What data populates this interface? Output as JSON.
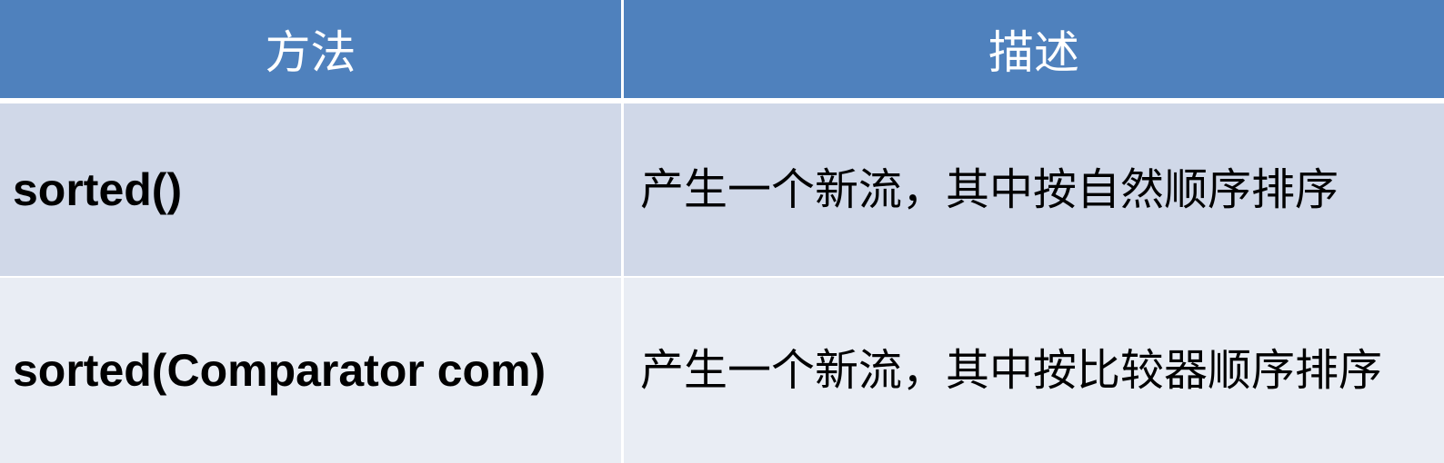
{
  "table": {
    "headers": [
      "方法",
      "描述"
    ],
    "rows": [
      {
        "method": "sorted()",
        "description": "产生一个新流，其中按自然顺序排序"
      },
      {
        "method": "sorted(Comparator com)",
        "description": "产生一个新流，其中按比较器顺序排序"
      }
    ]
  },
  "colors": {
    "header_bg": "#4f81bd",
    "row_odd_bg": "#d0d8e8",
    "row_even_bg": "#e9edf4",
    "header_text": "#ffffff"
  }
}
